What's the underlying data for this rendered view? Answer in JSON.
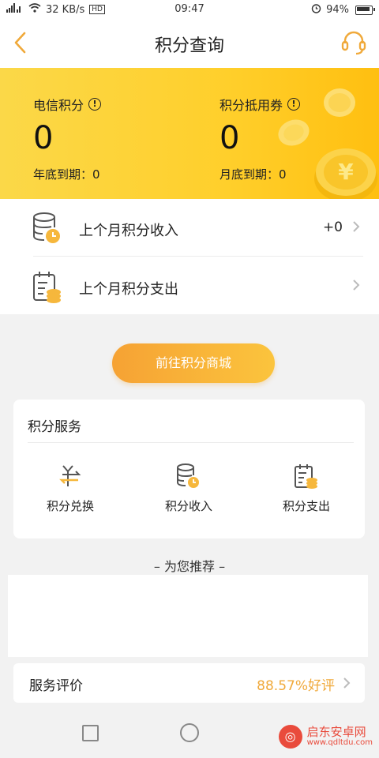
{
  "status_bar": {
    "network": "4G",
    "speed": "32 KB/s",
    "hd": "HD",
    "time": "09:47",
    "battery": "94%"
  },
  "header": {
    "title": "积分查询"
  },
  "points": {
    "telecom_label": "电信积分",
    "telecom_value": "0",
    "telecom_expiry": "年底到期：0",
    "voucher_label": "积分抵用券",
    "voucher_value": "0",
    "voucher_expiry": "月底到期：0"
  },
  "list": [
    {
      "label": "上个月积分收入",
      "value": "+0"
    },
    {
      "label": "上个月积分支出",
      "value": ""
    }
  ],
  "mall_button": "前往积分商城",
  "services": {
    "title": "积分服务",
    "items": [
      {
        "label": "积分兑换",
        "icon": "exchange-icon"
      },
      {
        "label": "积分收入",
        "icon": "income-icon"
      },
      {
        "label": "积分支出",
        "icon": "expense-icon"
      }
    ]
  },
  "recommend": {
    "title": "– 为您推荐 –"
  },
  "rating": {
    "label": "服务评价",
    "value": "88.57%好评"
  },
  "watermark": {
    "name": "启东安卓网",
    "url": "www.qdltdu.com"
  },
  "colors": {
    "accent_orange": "#f0a93a",
    "banner_yellow": "#ffcf2b"
  }
}
